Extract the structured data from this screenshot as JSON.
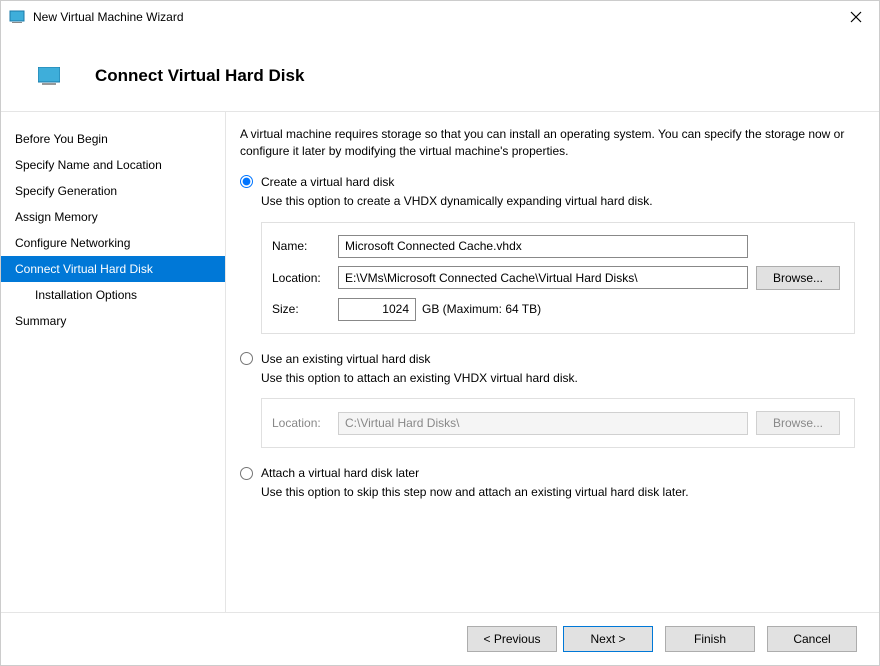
{
  "window": {
    "title": "New Virtual Machine Wizard"
  },
  "header": {
    "title": "Connect Virtual Hard Disk"
  },
  "sidebar": {
    "steps": [
      "Before You Begin",
      "Specify Name and Location",
      "Specify Generation",
      "Assign Memory",
      "Configure Networking",
      "Connect Virtual Hard Disk",
      "Installation Options",
      "Summary"
    ]
  },
  "content": {
    "intro": "A virtual machine requires storage so that you can install an operating system. You can specify the storage now or configure it later by modifying the virtual machine's properties.",
    "option_create": {
      "label": "Create a virtual hard disk",
      "hint": "Use this option to create a VHDX dynamically expanding virtual hard disk.",
      "name_label": "Name:",
      "name_value": "Microsoft Connected Cache.vhdx",
      "location_label": "Location:",
      "location_value": "E:\\VMs\\Microsoft Connected Cache\\Virtual Hard Disks\\",
      "browse_label": "Browse...",
      "size_label": "Size:",
      "size_value": "1024",
      "size_suffix": "GB (Maximum: 64 TB)"
    },
    "option_existing": {
      "label": "Use an existing virtual hard disk",
      "hint": "Use this option to attach an existing VHDX virtual hard disk.",
      "location_label": "Location:",
      "location_value": "C:\\Virtual Hard Disks\\",
      "browse_label": "Browse..."
    },
    "option_later": {
      "label": "Attach a virtual hard disk later",
      "hint": "Use this option to skip this step now and attach an existing virtual hard disk later."
    }
  },
  "footer": {
    "previous": "< Previous",
    "next": "Next >",
    "finish": "Finish",
    "cancel": "Cancel"
  }
}
